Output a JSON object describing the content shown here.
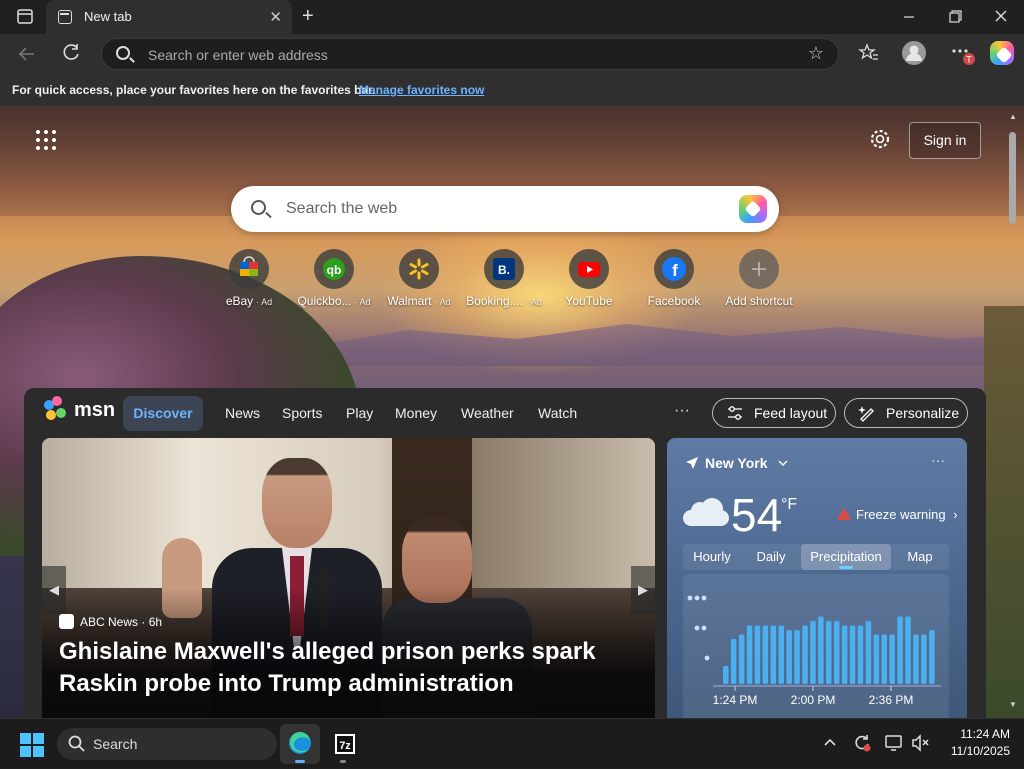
{
  "browser": {
    "tab_title": "New tab",
    "address_placeholder": "Search or enter web address",
    "favorites_message": "For quick access, place your favorites here on the favorites bar.",
    "favorites_link": "Manage favorites now",
    "profile_badge": "T"
  },
  "newtab": {
    "sign_in": "Sign in",
    "search_placeholder": "Search the web",
    "shortcuts": [
      {
        "label": "eBay",
        "ad": "· Ad",
        "icon": "ebay-icon"
      },
      {
        "label": "Quickbo...",
        "ad": "· Ad",
        "icon": "quickbooks-icon"
      },
      {
        "label": "Walmart",
        "ad": "· Ad",
        "icon": "walmart-icon"
      },
      {
        "label": "Booking....",
        "ad": "· Ad",
        "icon": "booking-icon"
      },
      {
        "label": "YouTube",
        "ad": "",
        "icon": "youtube-icon"
      },
      {
        "label": "Facebook",
        "ad": "",
        "icon": "facebook-icon"
      },
      {
        "label": "Add shortcut",
        "ad": "",
        "icon": "plus-icon"
      }
    ]
  },
  "msn": {
    "logo": "msn",
    "tabs": [
      "Discover",
      "News",
      "Sports",
      "Play",
      "Money",
      "Weather",
      "Watch"
    ],
    "more": "···",
    "feed_layout": "Feed layout",
    "personalize": "Personalize",
    "hero": {
      "source": "ABC News",
      "age": "· 6h",
      "headline": "Ghislaine Maxwell's alleged prison perks spark Raskin probe into Trump administration"
    },
    "weather": {
      "location": "New York",
      "more": "···",
      "temperature": "54",
      "unit": "°F",
      "alert": "Freeze warning",
      "tabs": [
        "Hourly",
        "Daily",
        "Precipitation",
        "Map"
      ],
      "active_tab": "Precipitation",
      "time_labels": [
        "1:24 PM",
        "2:00 PM",
        "2:36 PM"
      ]
    }
  },
  "chart_data": {
    "type": "bar",
    "title": "",
    "xlabel": "",
    "ylabel": "",
    "x_ticks": [
      "1:24 PM",
      "2:00 PM",
      "2:36 PM"
    ],
    "values": [
      0.2,
      0.5,
      0.55,
      0.65,
      0.65,
      0.65,
      0.65,
      0.65,
      0.6,
      0.6,
      0.65,
      0.7,
      0.75,
      0.7,
      0.7,
      0.65,
      0.65,
      0.65,
      0.7,
      0.55,
      0.55,
      0.55,
      0.75,
      0.75,
      0.55,
      0.55,
      0.6
    ],
    "ylim": [
      0,
      1
    ],
    "color": "#4ab0f0"
  },
  "taskbar": {
    "search": "Search",
    "time": "11:24 AM",
    "date": "11/10/2025"
  }
}
